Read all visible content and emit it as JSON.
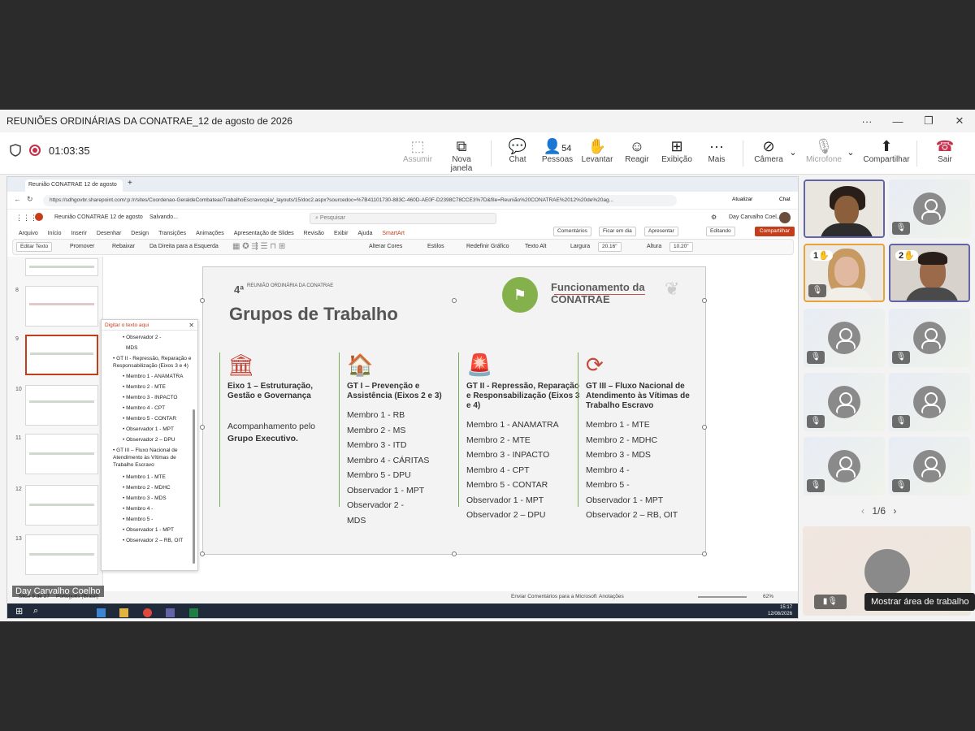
{
  "window": {
    "title": "REUNIÕES ORDINÁRIAS DA CONATRAE_12 de agosto de 2026",
    "more": "···",
    "minimize": "—",
    "restore": "❐",
    "close": "✕"
  },
  "toolbar": {
    "timer": "01:03:35",
    "assumir": "Assumir",
    "nova_janela": "Nova janela",
    "chat": "Chat",
    "pessoas": "Pessoas",
    "pessoas_count": "54",
    "levantar": "Levantar",
    "reagir": "Reagir",
    "exibicao": "Exibição",
    "mais": "Mais",
    "camera": "Câmera",
    "microfone": "Microfone",
    "compartilhar": "Compartilhar",
    "sair": "Sair"
  },
  "browser": {
    "tab_title": "Reunião CONATRAE 12 de agosto",
    "url": "https://sdhgovbr.sharepoint.com/:p:/r/sites/Coordenao-GeraldeCombateaoTrabalhoEscravocpia/_layouts/15/doc2.aspx?sourcedoc=%7B41101730-883C-460D-AE0F-D2398C78CCE3%7D&file=Reunião%20CONATRAE%2012%20de%20ag...",
    "atualizar": "Atualizar",
    "chat": "Chat"
  },
  "ppt": {
    "doc_title": "Reunião CONATRAE 12 de agosto",
    "saving": "Salvando...",
    "search_placeholder": "Pesquisar",
    "user": "Day Carvalho Coel...",
    "menu": [
      "Arquivo",
      "Início",
      "Inserir",
      "Desenhar",
      "Design",
      "Transições",
      "Animações",
      "Apresentação de Slides",
      "Revisão",
      "Exibir",
      "Ajuda",
      "SmartArt"
    ],
    "comentarios": "Comentários",
    "ficar_em_dia": "Ficar em dia",
    "apresentar": "Apresentar",
    "editando": "Editando",
    "compartilhar": "Compartilhar",
    "ribbon": {
      "editar_texto": "Editar Texto",
      "promover": "Promover",
      "rebaixar": "Rebaixar",
      "direita_esquerda": "Da Direita para a Esquerda",
      "alterar_cores": "Alterar Cores",
      "estilos": "Estilos",
      "redefinir": "Redefinir Gráfico",
      "texto_alt": "Texto Alt",
      "largura": "Largura",
      "largura_val": "20.16\"",
      "altura": "Altura",
      "altura_val": "10.20\""
    },
    "thumb_numbers": [
      "8",
      "9",
      "10",
      "11",
      "12",
      "13"
    ],
    "status_left": "Slide 9 de 27",
    "status_lang": "Português (Brasil)",
    "status_feedback": "Enviar Comentários para a Microsoft",
    "status_notes": "Anotações",
    "zoom": "62%",
    "clock": "15:17",
    "date": "12/08/2026"
  },
  "text_pane": {
    "title": "Digitar o texto aqui",
    "lines": [
      "Observador 2 -",
      "MDS",
      "GT II - Repressão, Reparação e",
      "Responsabilização (Eixos 3 e 4)",
      "Membro 1 - ANAMATRA",
      "Membro 2 - MTE",
      "Membro 3 - INPACTO",
      "Membro 4 - CPT",
      "Membro 5 - CONTAR",
      "Observador 1 - MPT",
      "Observador 2 – DPU",
      "GT III – Fluxo Nacional de",
      "Atendimento às Vítimas de",
      "Trabalho Escravo",
      "Membro 1 - MTE",
      "Membro 2 - MDHC",
      "Membro 3 - MDS",
      "Membro 4 -",
      "Membro 5 -",
      "Observador 1 - MPT",
      "Observador 2 – RB, OIT"
    ]
  },
  "slide": {
    "meeting_number": "4ª",
    "meeting_label": "REUNIÃO ORDINÁRIA DA CONATRAE",
    "title": "Grupos de Trabalho",
    "func_title": "Funcionamento da CONATRAE",
    "accent_green": "#85b14d",
    "accent_red": "#c4483b",
    "columns": [
      {
        "icon": "bank-icon",
        "head": "Eixo 1 – Estruturação, Gestão e Governança",
        "lines": [
          "Acompanhamento pelo",
          "Grupo Executivo."
        ]
      },
      {
        "icon": "house-signal-icon",
        "head": "GT I – Prevenção e Assistência (Eixos 2 e 3)",
        "lines": [
          "Membro 1 - RB",
          "Membro 2 - MS",
          "Membro 3 - ITD",
          "Membro 4 - CÁRITAS",
          "Membro 5 - DPU",
          "Observador 1 - MPT",
          "Observador 2 -",
          "MDS"
        ]
      },
      {
        "icon": "siren-icon",
        "head": "GT II - Repressão, Reparação e Responsabilização (Eixos 3 e 4)",
        "lines": [
          "Membro 1 - ANAMATRA",
          "Membro 2 - MTE",
          "Membro 3 - INPACTO",
          "Membro 4 - CPT",
          "Membro 5 - CONTAR",
          "Observador 1 - MPT",
          "Observador 2 – DPU"
        ]
      },
      {
        "icon": "cycle-arrows-icon",
        "head": "GT III – Fluxo Nacional de Atendimento às Vítimas de Trabalho Escravo",
        "lines": [
          "Membro 1 - MTE",
          "Membro 2 - MDHC",
          "Membro 3 - MDS",
          "Membro 4 -",
          "Membro 5 -",
          "Observador 1 - MPT",
          "Observador 2 – RB, OIT"
        ]
      }
    ]
  },
  "presenter_label": "Day Carvalho Coelho",
  "gallery": {
    "hand_1": "1",
    "hand_2": "2",
    "pager": "1/6",
    "tooltip": "Mostrar área de trabalho"
  }
}
